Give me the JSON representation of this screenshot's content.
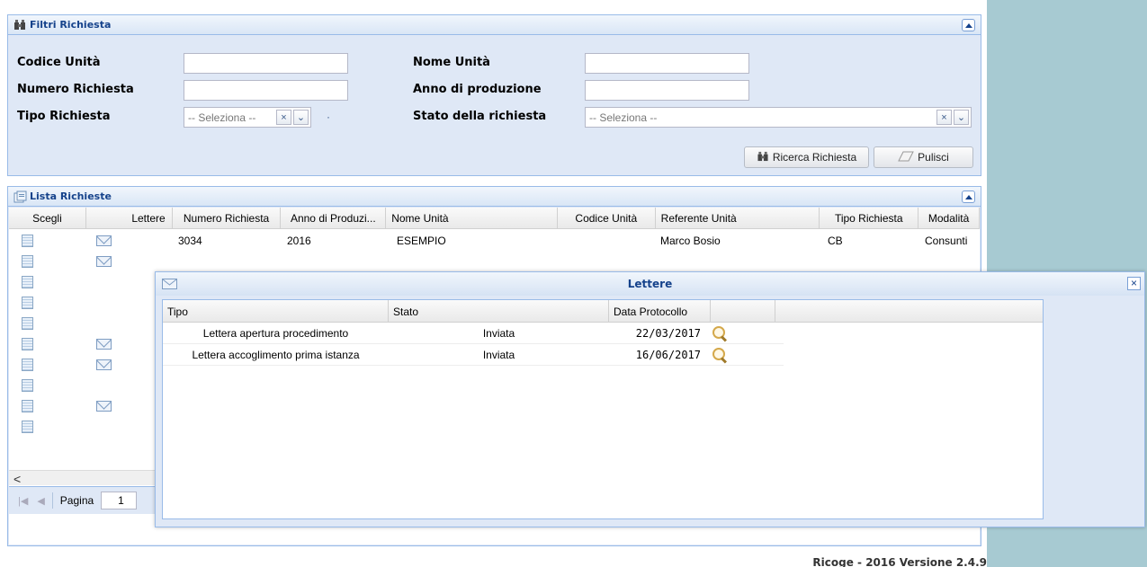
{
  "filtri": {
    "title": "Filtri Richiesta",
    "labels": {
      "codice_unita": "Codice Unità",
      "numero_richiesta": "Numero Richiesta",
      "tipo_richiesta": "Tipo Richiesta",
      "nome_unita": "Nome Unità",
      "anno_produzione": "Anno di produzione",
      "stato_richiesta": "Stato della richiesta"
    },
    "values": {
      "codice_unita": "",
      "numero_richiesta": "",
      "nome_unita": "",
      "anno_produzione": ""
    },
    "tipo_richiesta_placeholder": "-- Seleziona --",
    "stato_richiesta_placeholder": "-- Seleziona --",
    "clear_glyph": "×",
    "dropdown_glyph": "⌄",
    "dot": "·",
    "buttons": {
      "ricerca": "Ricerca Richiesta",
      "pulisci": "Pulisci"
    }
  },
  "lista": {
    "title": "Lista Richieste",
    "columns": [
      "Scegli",
      "Lettere",
      "Numero Richiesta",
      "Anno di Produzi...",
      "Nome Unità",
      "Codice Unità",
      "Referente Unità",
      "Tipo Richiesta",
      "Modalità"
    ],
    "first_row": {
      "numero": "3034",
      "anno": "2016",
      "nome": "ESEMPIO",
      "codice": "",
      "referente": "Marco Bosio",
      "tipo": "CB",
      "modalita": "Consunti"
    },
    "row_has_letter": [
      true,
      true,
      false,
      false,
      false,
      true,
      true,
      false,
      true,
      false
    ],
    "scroll_left_glyph": "<",
    "pager": {
      "label": "Pagina",
      "page": "1"
    }
  },
  "lettere_window": {
    "title": "Lettere",
    "close_glyph": "×",
    "columns": [
      "Tipo",
      "Stato",
      "Data Protocollo",
      ""
    ],
    "rows": [
      {
        "tipo": "Lettera apertura procedimento",
        "stato": "Inviata",
        "data": "22/03/2017"
      },
      {
        "tipo": "Lettera accoglimento prima istanza",
        "stato": "Inviata",
        "data": "16/06/2017"
      }
    ]
  },
  "footer": {
    "text": "Ricoge - 2016 Versione 2.4.9"
  },
  "colors": {
    "panel_bg": "#dfe8f6",
    "header_text": "#15428b",
    "right_band": "#a7cad2"
  }
}
